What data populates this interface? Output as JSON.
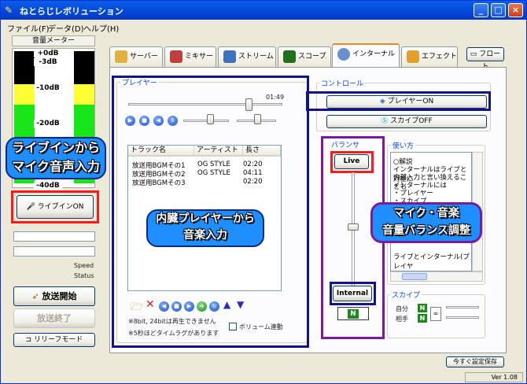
{
  "window": {
    "title": "ねとらじレボリューション",
    "version": "Ver 1.08"
  },
  "menu": [
    "ファイル(F)",
    "データ(D)",
    "ヘルプ(H)"
  ],
  "meter": {
    "title": "音量メーター",
    "ticks": [
      "+0dB",
      "-3dB",
      "-10dB",
      "-20dB",
      "-30dB",
      "-40dB"
    ],
    "colors": {
      "red": "#000000",
      "yellow": "#ffff00",
      "green": "#19e619",
      "top": "#000000"
    }
  },
  "left": {
    "line_in_button": "ライブインON",
    "speed_label": "Speed",
    "status_label": "Status",
    "start_button": "放送開始",
    "stop_button": "放送終了",
    "relay_button": "リリーフモード"
  },
  "tabs": [
    "サーバー",
    "ミキサー",
    "ストリーム",
    "スコープ",
    "インターナル",
    "エフェクト"
  ],
  "float_button": "フロート",
  "player": {
    "group_label": "プレイヤー",
    "time": "01:49",
    "columns": [
      "トラック名",
      "アーティスト",
      "長さ"
    ],
    "rows": [
      [
        "放送用BGMその1",
        "OG STYLE",
        "02:20"
      ],
      [
        "放送用BGMその2",
        "OG STYLE",
        "04:11"
      ],
      [
        "放送用BGMその3",
        "",
        "02:20"
      ]
    ],
    "note1": "※8bit, 24bitは再生できません",
    "note2": "※5秒ほどタイムラグがあります",
    "volume_link": "ボリューム連動"
  },
  "control": {
    "group_label": "コントロール",
    "player_on": "プレイヤーON",
    "skype_off": "スカイプOFF"
  },
  "balancer": {
    "group_label": "バランサ",
    "live": "Live",
    "internal": "Internal"
  },
  "usage": {
    "group_label": "使い方",
    "lines": [
      "○解説",
      "インターナルはライブと対極に",
      "内部入力と言い換えることも",
      "インターナルには",
      "・プレイヤー",
      "・スカイプ"
    ],
    "footer": "ライブとインターナル(プレイヤ"
  },
  "skype": {
    "group_label": "スカイプ",
    "self": "自分",
    "partner": "相手",
    "n": "N"
  },
  "save_button": "今すぐ設定保存",
  "annotations": {
    "linein": [
      "ライブインから",
      "マイク音声入力"
    ],
    "player": [
      "内臓プレイヤーから",
      "音楽入力"
    ],
    "balance": [
      "マイク・音楽",
      "音量バランス調整"
    ]
  }
}
